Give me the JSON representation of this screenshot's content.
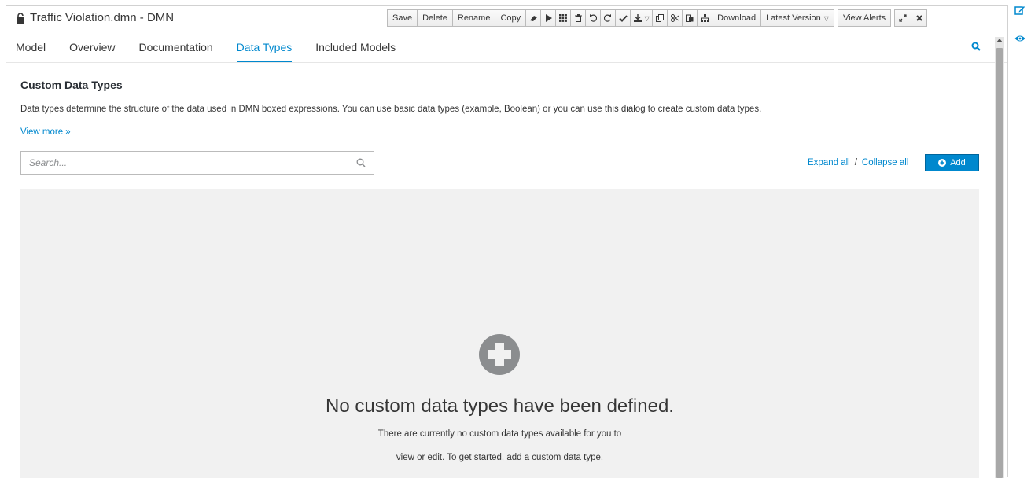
{
  "window": {
    "title": "Traffic Violation.dmn - DMN"
  },
  "toolbar": {
    "save": "Save",
    "delete": "Delete",
    "rename": "Rename",
    "copy": "Copy",
    "download": "Download",
    "latest_version": "Latest Version",
    "view_alerts": "View Alerts",
    "icons": [
      "eraser-icon",
      "play-icon",
      "grid-icon",
      "trash-icon",
      "undo-icon",
      "redo-icon",
      "check-icon",
      "deploy-icon",
      "duplicate-icon",
      "cut-icon",
      "paste-icon",
      "hierarchy-icon",
      "maximize-icon",
      "close-icon"
    ]
  },
  "tabs": [
    {
      "label": "Model",
      "active": false
    },
    {
      "label": "Overview",
      "active": false
    },
    {
      "label": "Documentation",
      "active": false
    },
    {
      "label": "Data Types",
      "active": true
    },
    {
      "label": "Included Models",
      "active": false
    }
  ],
  "content": {
    "heading": "Custom Data Types",
    "description": "Data types determine the structure of the data used in DMN boxed expressions. You can use basic data types (example, Boolean) or you can use this dialog to create custom data types.",
    "view_more": "View more »",
    "search_placeholder": "Search...",
    "expand_all": "Expand all",
    "separator": "/",
    "collapse_all": "Collapse all",
    "add_label": "Add"
  },
  "empty_state": {
    "title": "No custom data types have been defined.",
    "line1": "There are currently no custom data types available for you to",
    "line2": "view or edit. To get started, add a custom data type."
  },
  "colors": {
    "accent": "#0088ce",
    "empty_bg": "#f1f1f1",
    "plus_icon": "#8b8d8f"
  }
}
